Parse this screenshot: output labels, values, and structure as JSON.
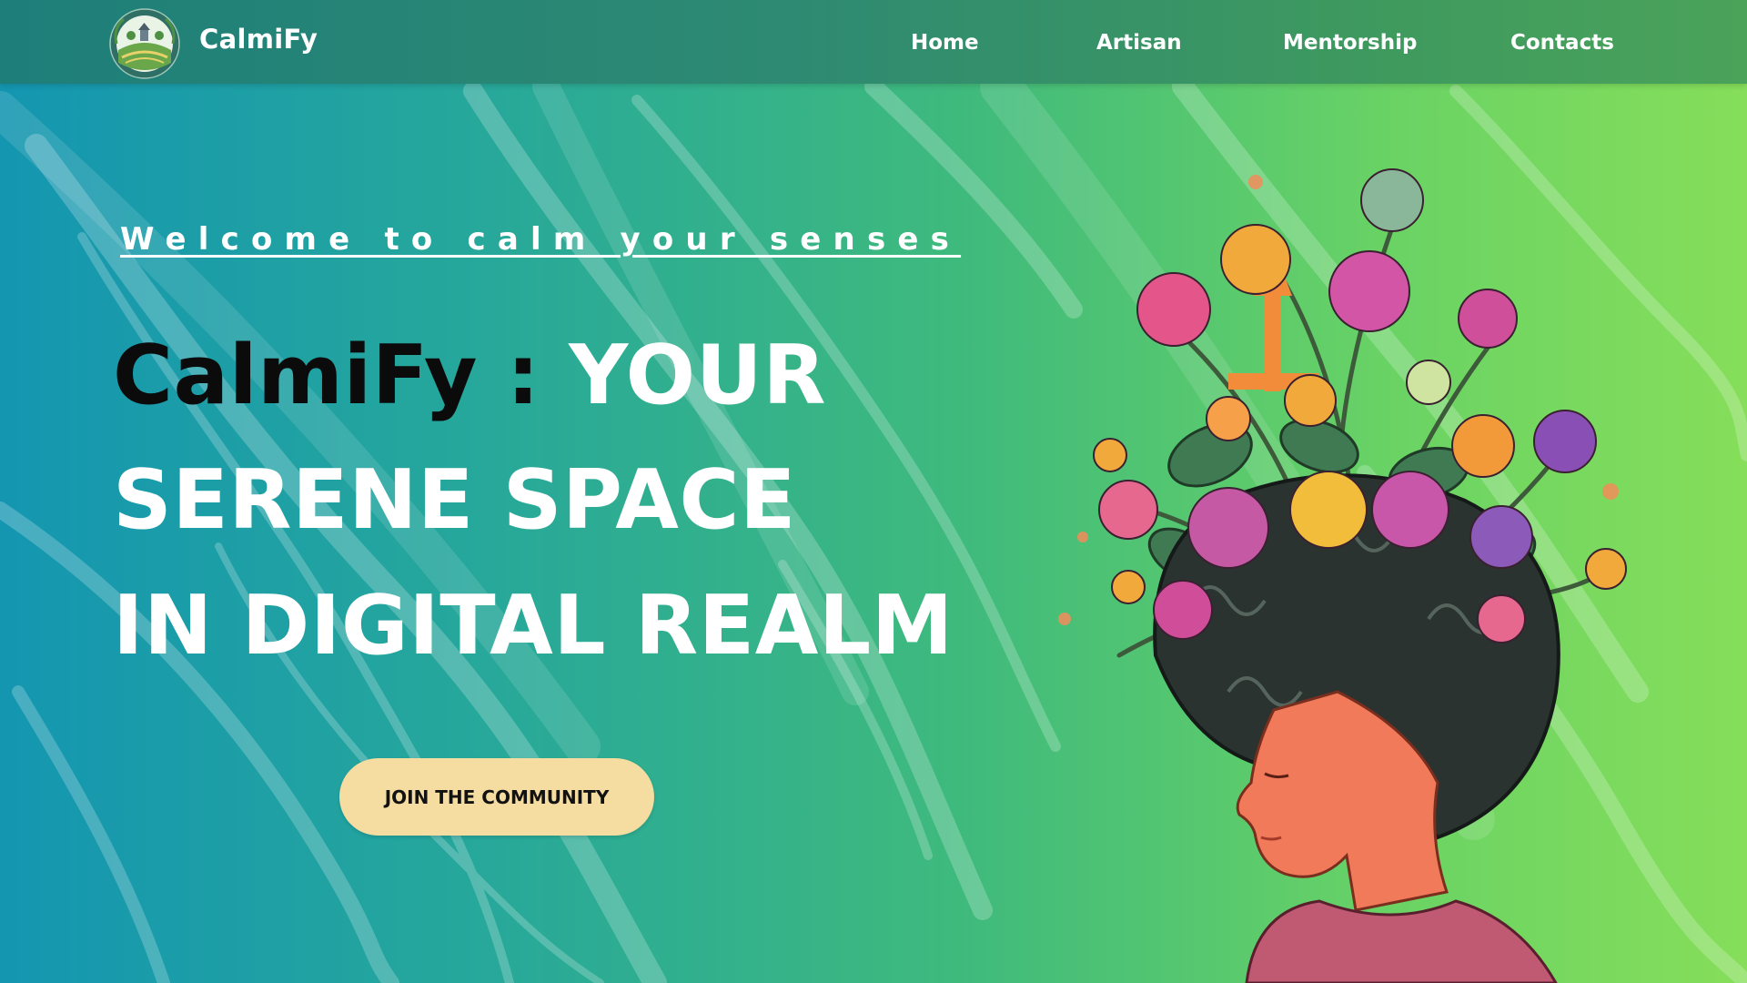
{
  "header": {
    "brand": "CalmiFy",
    "nav": [
      {
        "label": "Home"
      },
      {
        "label": "Artisan"
      },
      {
        "label": "Mentorship"
      },
      {
        "label": "Contacts"
      }
    ]
  },
  "hero": {
    "tagline": "Welcome to calm your senses",
    "headline": {
      "brand_part": "CalmiFy :",
      "line1_rest": "YOUR",
      "line2": "SERENE SPACE",
      "line3": "IN DIGITAL REALM"
    },
    "cta_label": "JOIN THE COMMUNITY"
  },
  "colors": {
    "gradient_start": "#1496b1",
    "gradient_end": "#86de5a",
    "navbar": "#2e8a72",
    "cta_background": "#f5dca0",
    "headline_brand": "#0b0b0b",
    "headline": "#ffffff"
  },
  "icons": {
    "logo": "calmify-logo-icon",
    "illustration": "woman-flower-head-illustration"
  }
}
